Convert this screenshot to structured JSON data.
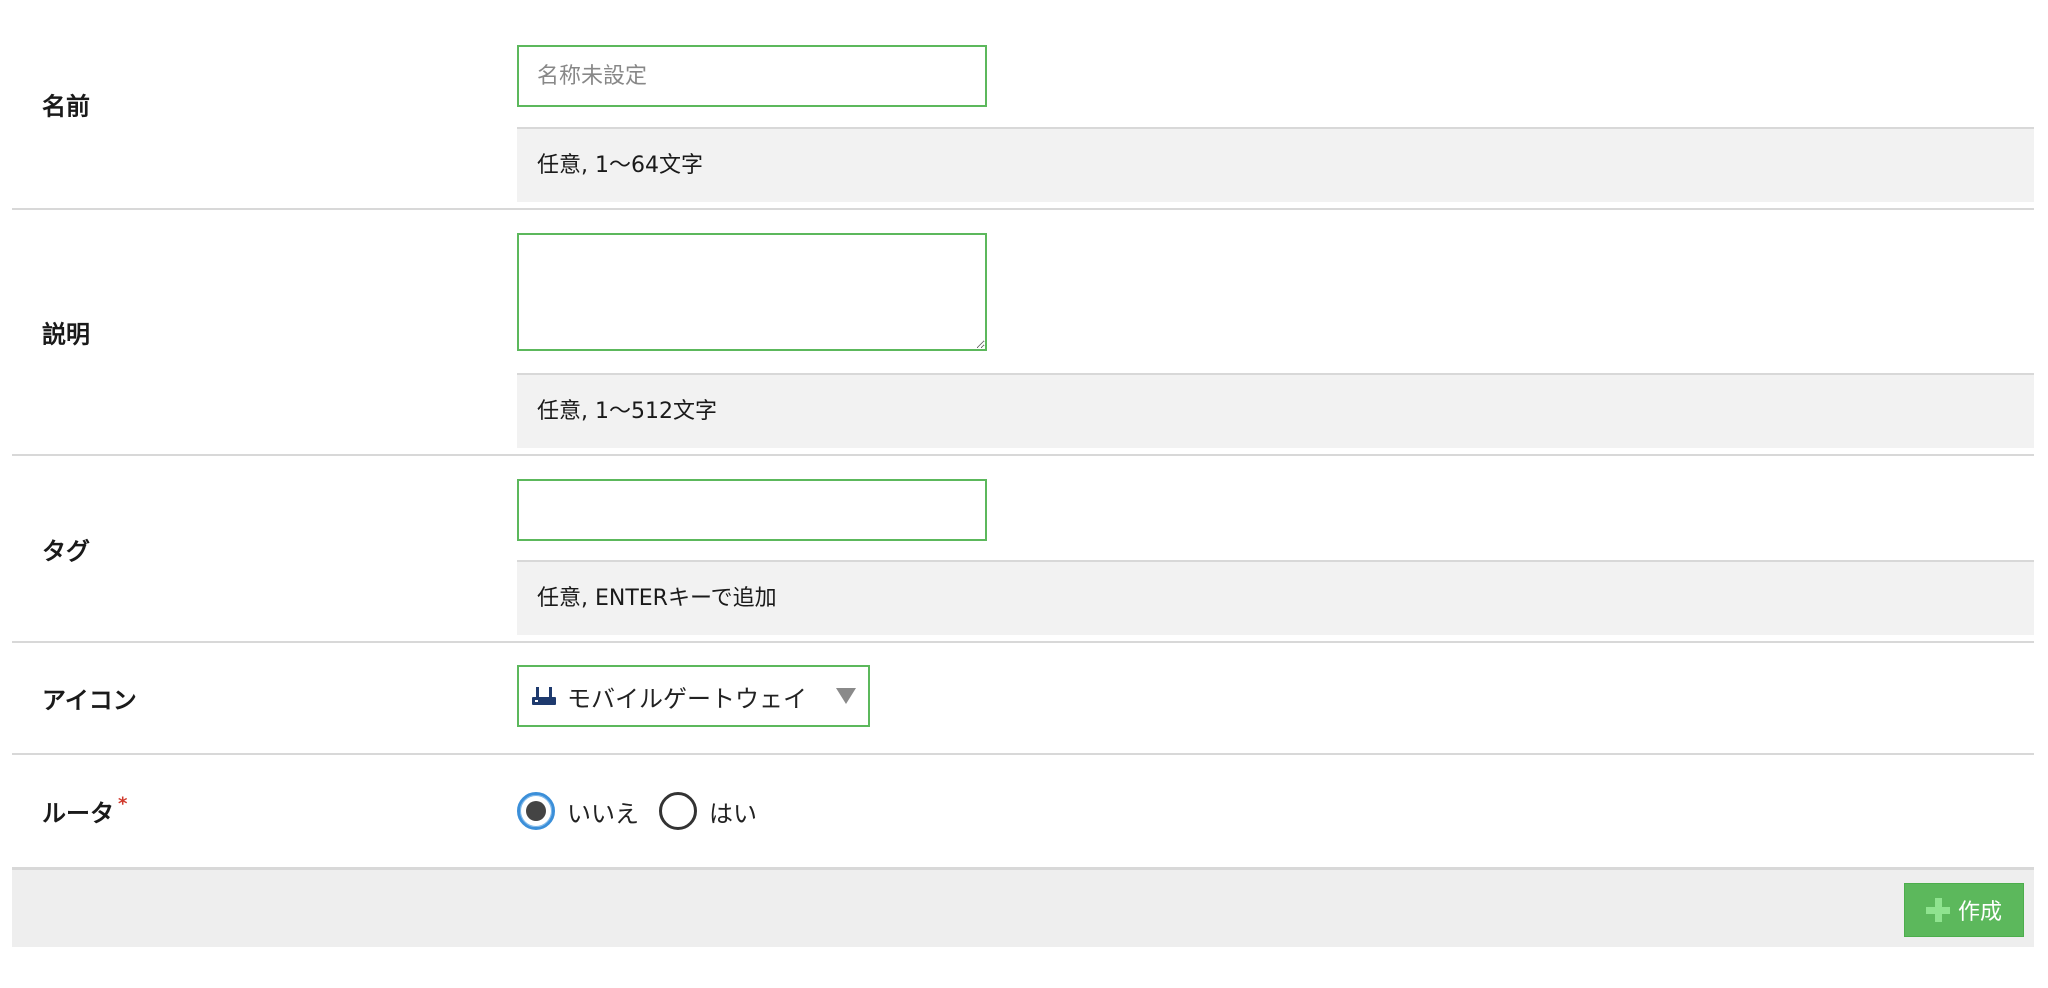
{
  "form": {
    "name": {
      "label": "名前",
      "placeholder": "名称未設定",
      "value": "",
      "hint": "任意, 1〜64文字"
    },
    "description": {
      "label": "説明",
      "value": "",
      "hint": "任意, 1〜512文字"
    },
    "tags": {
      "label": "タグ",
      "value": "",
      "hint": "任意, ENTERキーで追加"
    },
    "icon": {
      "label": "アイコン",
      "selected": "モバイルゲートウェイ",
      "selected_icon": "router-icon",
      "icon_color": "#1e3a6e"
    },
    "router": {
      "label": "ルータ",
      "required_mark": "*",
      "options": [
        {
          "label": "いいえ",
          "selected": true
        },
        {
          "label": "はい",
          "selected": false
        }
      ]
    }
  },
  "footer": {
    "create_label": "作成",
    "create_icon": "plus-icon"
  },
  "colors": {
    "accent_green": "#5cb85c",
    "hint_bg": "#f2f2f2",
    "radio_selected": "#3b8fd9",
    "required": "#d0392c"
  }
}
